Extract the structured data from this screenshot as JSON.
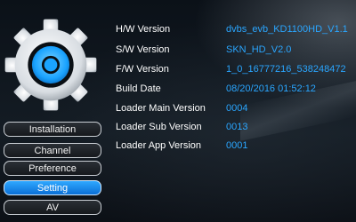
{
  "info_rows": [
    {
      "label": "H/W Version",
      "value": "dvbs_evb_KD1100HD_V1.1"
    },
    {
      "label": "S/W Version",
      "value": "SKN_HD_V2.0"
    },
    {
      "label": "F/W Version",
      "value": "1_0_16777216_538248472"
    },
    {
      "label": "Build Date",
      "value": "08/20/2016 01:52:12"
    },
    {
      "label": "Loader Main Version",
      "value": "0004"
    },
    {
      "label": "Loader Sub Version",
      "value": "0013"
    },
    {
      "label": "Loader App Version",
      "value": "0001"
    }
  ],
  "menu": {
    "items": [
      {
        "label": "Installation"
      },
      {
        "label": "Channel"
      },
      {
        "label": "Preference"
      },
      {
        "label": "Setting"
      },
      {
        "label": "AV"
      }
    ],
    "selected": "Setting"
  },
  "colors": {
    "value_text": "#2aa6ff",
    "label_text": "#ffffff",
    "selected_item": "#1a8cff",
    "gear": "#e9eef2",
    "gear_center": "#1aa3ff"
  },
  "icons": {
    "header_icon": "gear-icon"
  }
}
